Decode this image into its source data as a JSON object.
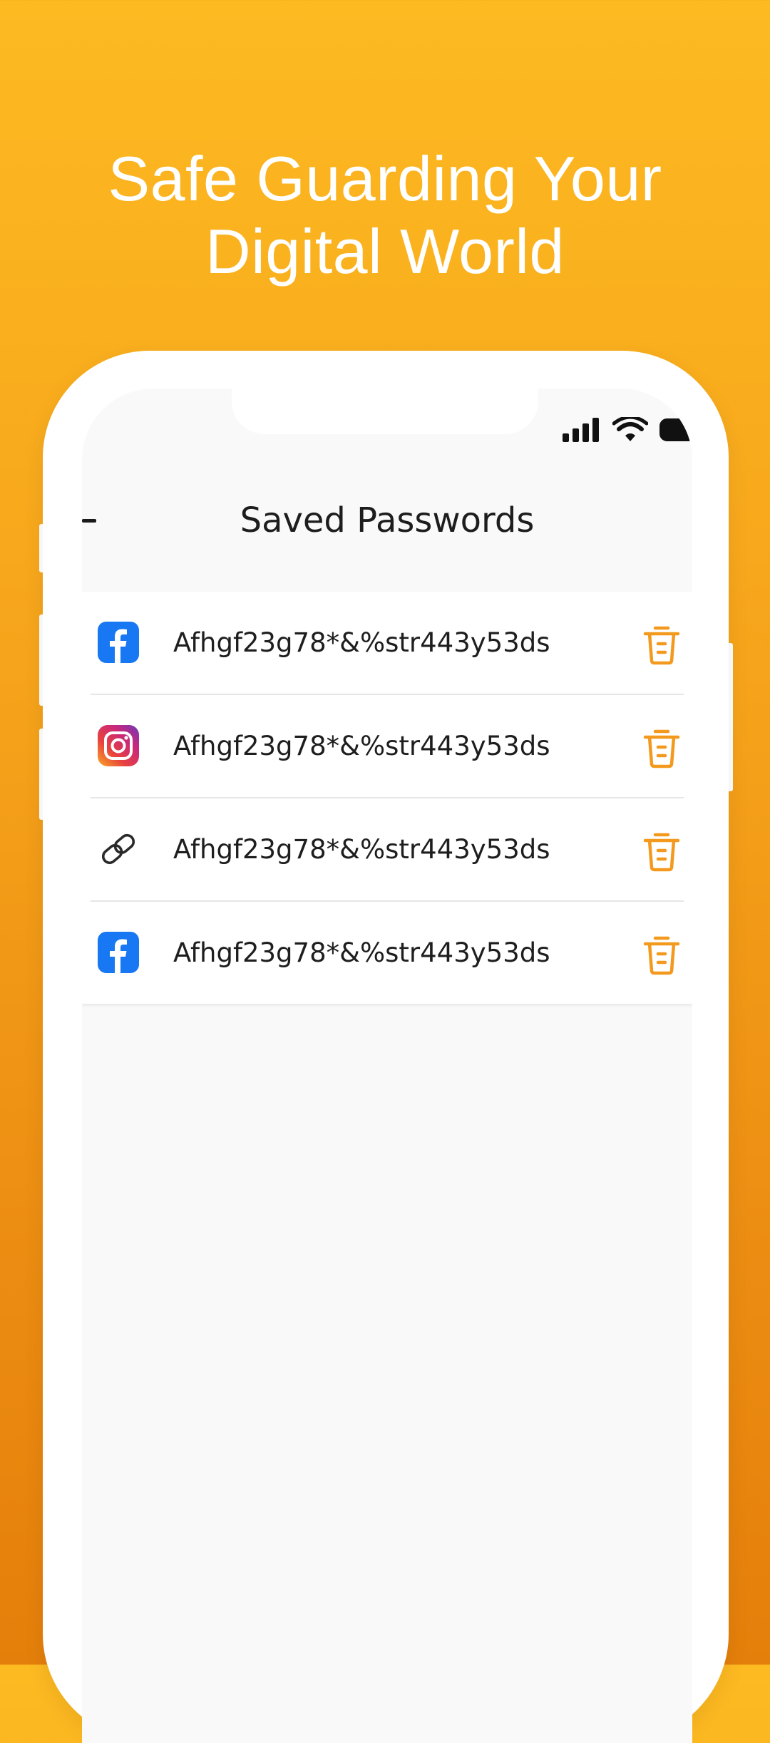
{
  "headline": {
    "line1": "Safe Guarding Your",
    "line2": "Digital World"
  },
  "colors": {
    "accent": "#F39A1E",
    "background_top": "#FDBA21",
    "background_bottom": "#E57F0B",
    "facebook": "#1877F2"
  },
  "status_bar": {
    "icons": [
      "signal-icon",
      "wifi-icon",
      "battery-icon"
    ]
  },
  "appbar": {
    "title": "Saved Passwords",
    "back_icon": "back-icon"
  },
  "passwords": [
    {
      "service_icon": "facebook-icon",
      "password": "Afhgf23g78*&%str443y53ds",
      "delete_icon": "trash-icon"
    },
    {
      "service_icon": "instagram-icon",
      "password": "Afhgf23g78*&%str443y53ds",
      "delete_icon": "trash-icon"
    },
    {
      "service_icon": "link-icon",
      "password": "Afhgf23g78*&%str443y53ds",
      "delete_icon": "trash-icon"
    },
    {
      "service_icon": "facebook-icon",
      "password": "Afhgf23g78*&%str443y53ds",
      "delete_icon": "trash-icon"
    }
  ]
}
